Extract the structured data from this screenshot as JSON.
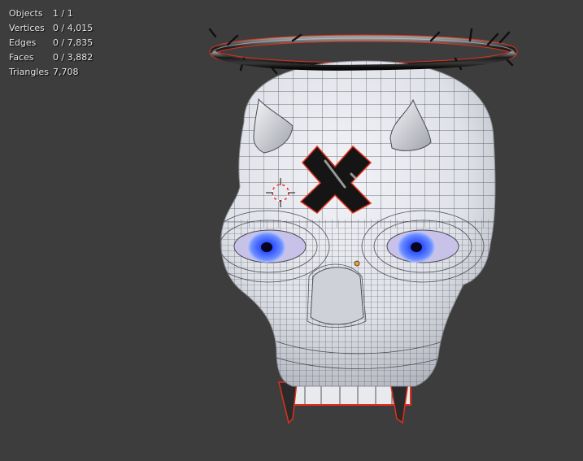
{
  "viewport": {
    "background": "#3d3d3d",
    "stats": [
      {
        "label": "Objects",
        "value": "1 / 1"
      },
      {
        "label": "Vertices",
        "value": "0 / 4,015"
      },
      {
        "label": "Edges",
        "value": "0 / 7,835"
      },
      {
        "label": "Faces",
        "value": "0 / 3,882"
      },
      {
        "label": "Triangles",
        "value": "7,708"
      }
    ]
  },
  "scene": {
    "object": "skull-mesh",
    "iris_color": "#3a5cf5",
    "selection_outline": "#e0301c",
    "origin_color": "#f0a030"
  }
}
